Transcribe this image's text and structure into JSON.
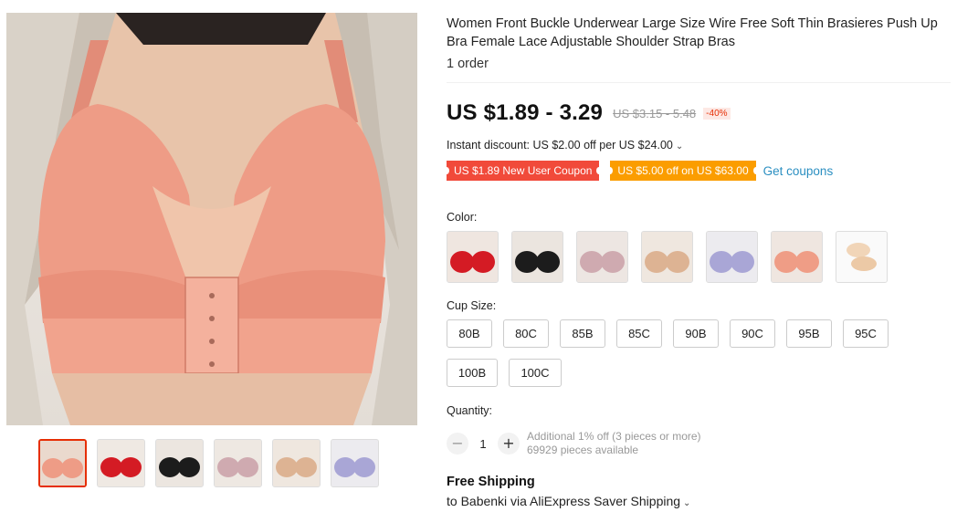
{
  "product": {
    "title": "Women Front Buckle Underwear Large Size Wire Free Soft Thin Brasieres Push Up Bra Female Lace Adjustable Shoulder Strap Bras",
    "orders": "1 order"
  },
  "price": {
    "current": "US $1.89 - 3.29",
    "original": "US $3.15 - 5.48",
    "discount": "-40%"
  },
  "promotions": {
    "instant_discount": "Instant discount: US $2.00 off per US $24.00",
    "coupon_new_user": "US $1.89 New User Coupon",
    "coupon_off": "US $5.00 off on US $63.00",
    "get_coupons": "Get coupons"
  },
  "color": {
    "label": "Color:",
    "swatches": [
      {
        "name": "pink",
        "color": "#e79880"
      },
      {
        "name": "red",
        "color": "#d41b24"
      },
      {
        "name": "black",
        "color": "#1c1c1c"
      },
      {
        "name": "mauve",
        "color": "#cfaab0"
      },
      {
        "name": "skin",
        "color": "#ddb393"
      },
      {
        "name": "lavender",
        "color": "#a9a6d6"
      },
      {
        "name": "coral",
        "color": "#ef9d86"
      },
      {
        "name": "pads",
        "color": "#f1d5b8"
      }
    ]
  },
  "cup_size": {
    "label": "Cup Size:",
    "options": [
      "80B",
      "80C",
      "85B",
      "85C",
      "90B",
      "90C",
      "95B",
      "95C",
      "100B",
      "100C"
    ]
  },
  "quantity": {
    "label": "Quantity:",
    "value": "1",
    "minus": "−",
    "plus": "+",
    "additional": "Additional 1% off (3 pieces or more)",
    "available": "69929 pieces available"
  },
  "shipping": {
    "title": "Free Shipping",
    "detail": "to Babenki via AliExpress Saver Shipping"
  },
  "icons": {
    "chevron": "chevron-down-icon"
  },
  "colors": {
    "accent": "#e62e04",
    "coupon_red": "#f14a3a",
    "coupon_orange": "#fb9d00",
    "link": "#2b8fc1"
  }
}
